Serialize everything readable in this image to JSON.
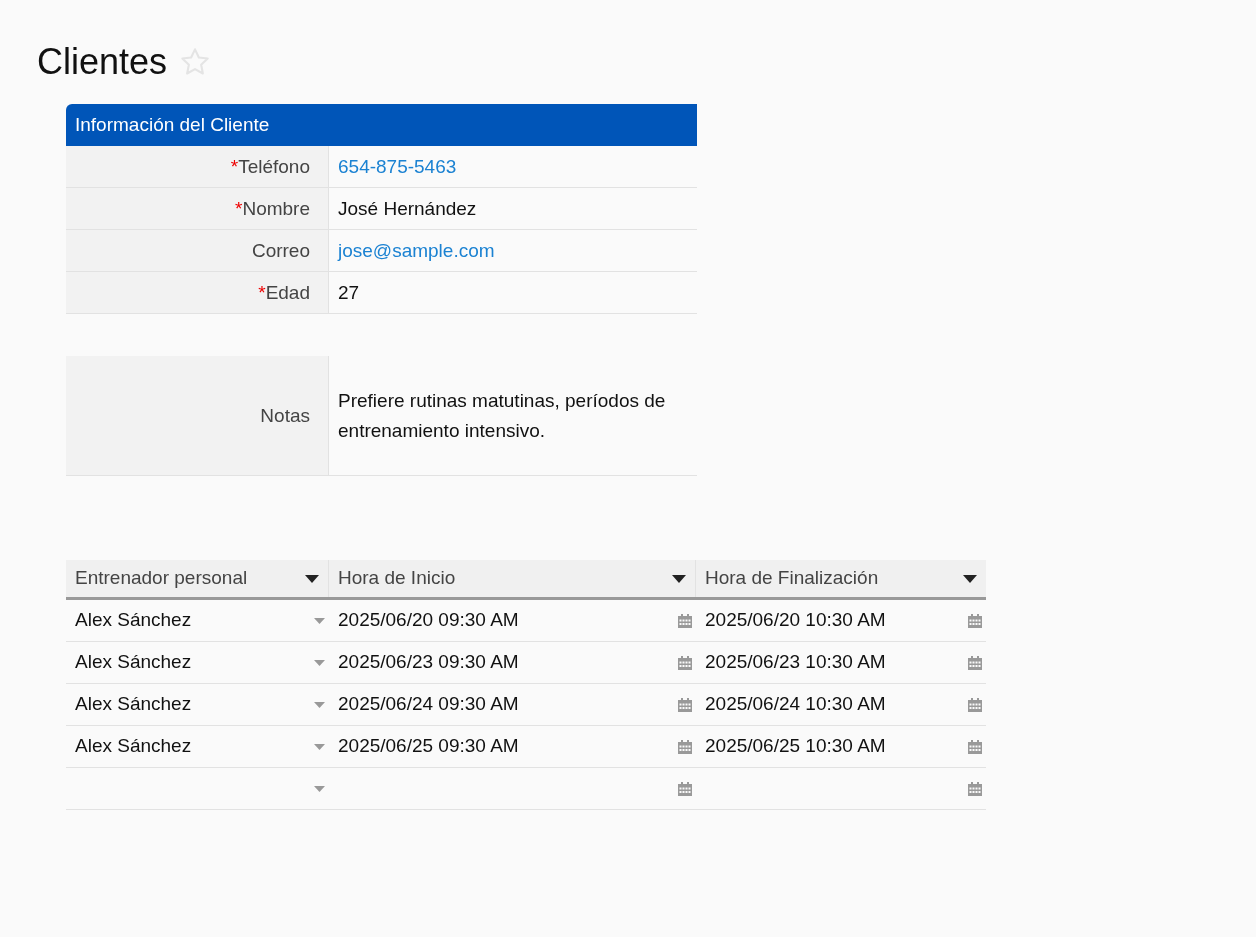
{
  "page": {
    "title": "Clientes",
    "favorite": false
  },
  "section": {
    "title": "Información del Cliente",
    "fields": [
      {
        "label": "Teléfono",
        "required_mark": "*",
        "value": "654-875-5463",
        "kind": "link"
      },
      {
        "label": "Nombre",
        "required_mark": "*",
        "value": "José Hernández",
        "kind": "text"
      },
      {
        "label": "Correo",
        "value": "jose@sample.com",
        "kind": "link"
      },
      {
        "label": "Edad",
        "required_mark": "*",
        "value": "27",
        "kind": "text"
      }
    ]
  },
  "notes": {
    "label": "Notas",
    "value": "Prefiere rutinas matutinas, períodos de entrenamiento intensivo."
  },
  "table": {
    "columns": [
      "Entrenador personal",
      "Hora de Inicio",
      "Hora de Finalización"
    ],
    "rows": [
      [
        "Alex Sánchez",
        "2025/06/20 09:30 AM",
        "2025/06/20 10:30 AM"
      ],
      [
        "Alex Sánchez",
        "2025/06/23 09:30 AM",
        "2025/06/23 10:30 AM"
      ],
      [
        "Alex Sánchez",
        "2025/06/24 09:30 AM",
        "2025/06/24 10:30 AM"
      ],
      [
        "Alex Sánchez",
        "2025/06/25 09:30 AM",
        "2025/06/25 10:30 AM"
      ],
      [
        "",
        "",
        ""
      ]
    ]
  }
}
